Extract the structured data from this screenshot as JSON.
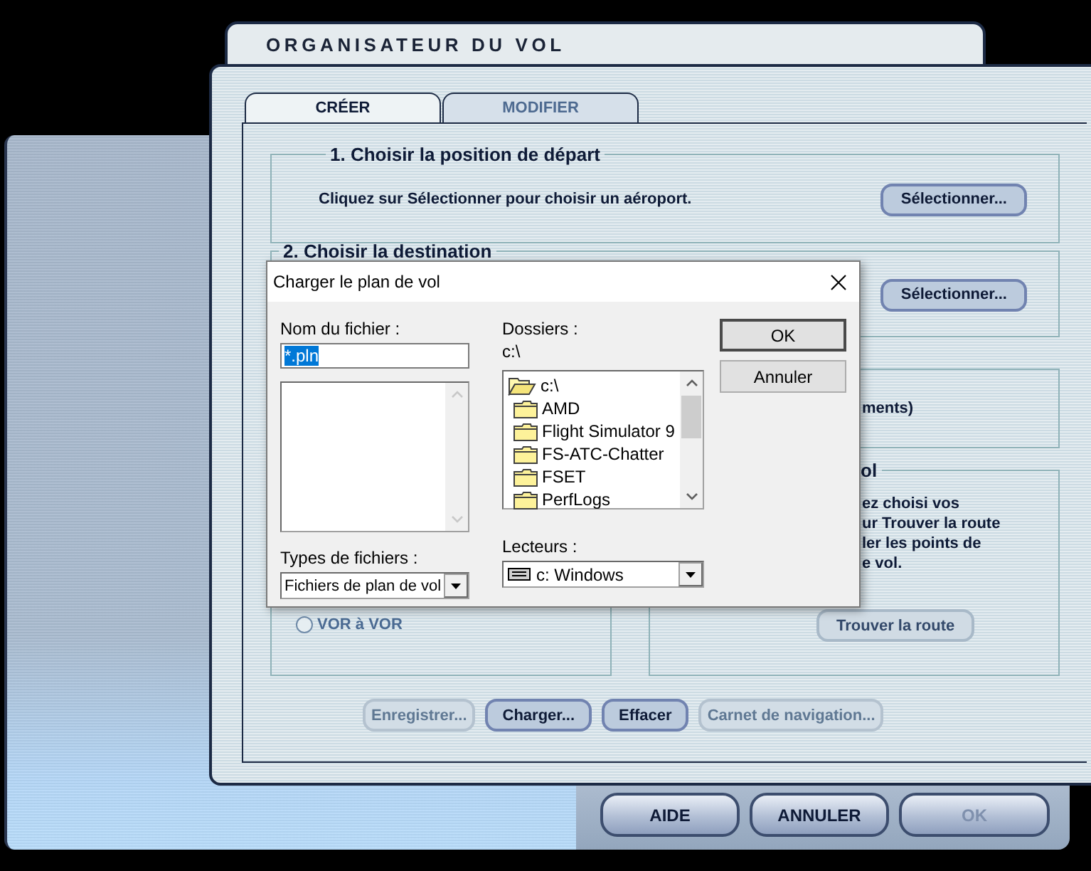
{
  "window": {
    "title": "ORGANISATEUR DU VOL"
  },
  "tabs": [
    {
      "label": "CRÉER",
      "selected": true
    },
    {
      "label": "MODIFIER",
      "selected": false
    }
  ],
  "departure": {
    "title": "1. Choisir la position de départ",
    "text": "Cliquez sur Sélectionner pour choisir un aéroport.",
    "button": "Sélectionner..."
  },
  "destination": {
    "title": "2. Choisir la destination",
    "button": "Sélectionner..."
  },
  "section_3": {
    "text": "ments)"
  },
  "route_type": {
    "options": [
      {
        "label": "VOR à VOR",
        "selected": false
      }
    ]
  },
  "section_4": {
    "title": "ol",
    "text": "ez choisi vos\nur Trouver la route\nler les points de\ne vol.",
    "button": "Trouver la route"
  },
  "actions": [
    {
      "label": "Enregistrer...",
      "disabled": true
    },
    {
      "label": "Charger...",
      "disabled": false
    },
    {
      "label": "Effacer",
      "disabled": false
    },
    {
      "label": "Carnet de navigation...",
      "disabled": true
    }
  ],
  "footer_buttons": [
    {
      "label": "AIDE",
      "disabled": false
    },
    {
      "label": "ANNULER",
      "disabled": false
    },
    {
      "label": "OK",
      "disabled": true
    }
  ],
  "dialog": {
    "title": "Charger le plan de vol",
    "file_name": {
      "label": "Nom du fichier :",
      "value": "*.pln",
      "selected": true
    },
    "file_types": {
      "label": "Types de fichiers :",
      "value": "Fichiers de plan de vol"
    },
    "folders": {
      "label": "Dossiers :",
      "path": "c:\\",
      "items": [
        {
          "name": "c:\\",
          "open": true
        },
        {
          "name": "AMD",
          "open": false
        },
        {
          "name": "Flight Simulator 9",
          "open": false
        },
        {
          "name": "FS-ATC-Chatter",
          "open": false
        },
        {
          "name": "FSET",
          "open": false
        },
        {
          "name": "PerfLogs",
          "open": false
        }
      ]
    },
    "drives": {
      "label": "Lecteurs :",
      "value": "c: Windows"
    },
    "buttons": [
      {
        "label": "OK",
        "default": true
      },
      {
        "label": "Annuler",
        "default": false
      }
    ]
  }
}
